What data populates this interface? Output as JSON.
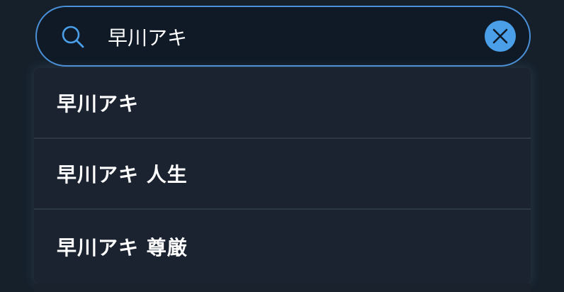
{
  "search": {
    "value": "早川アキ",
    "icon": "search-icon",
    "clear_icon": "close-icon"
  },
  "suggestions": [
    {
      "label": "早川アキ"
    },
    {
      "label": "早川アキ 人生"
    },
    {
      "label": "早川アキ 尊厳"
    }
  ],
  "colors": {
    "background": "#15202b",
    "accent": "#4a9fe8",
    "border": "#4a90d9",
    "text": "#ffffff"
  }
}
